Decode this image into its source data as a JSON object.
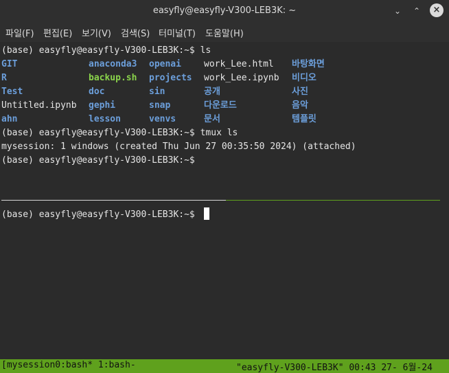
{
  "window": {
    "title": "easyfly@easyfly-V300-LEB3K: ~",
    "controls": [
      "minimize-icon",
      "maximize-icon",
      "close-icon"
    ]
  },
  "menu": [
    "파일(F)",
    "편집(E)",
    "보기(V)",
    "검색(S)",
    "터미널(T)",
    "도움말(H)"
  ],
  "terminal": {
    "prompt_ls": "(base) easyfly@easyfly-V300-LEB3K:~$ ls",
    "ls_rows": [
      [
        {
          "text": "GIT",
          "kind": "dir"
        },
        {
          "text": "anaconda3",
          "kind": "dir"
        },
        {
          "text": "openai",
          "kind": "dir"
        },
        {
          "text": "work_Lee.html",
          "kind": "file"
        },
        {
          "text": "바탕화면",
          "kind": "dir"
        }
      ],
      [
        {
          "text": "R",
          "kind": "dir"
        },
        {
          "text": "backup.sh",
          "kind": "exe"
        },
        {
          "text": "projects",
          "kind": "dir"
        },
        {
          "text": "work_Lee.ipynb",
          "kind": "file"
        },
        {
          "text": "비디오",
          "kind": "dir"
        }
      ],
      [
        {
          "text": "Test",
          "kind": "dir"
        },
        {
          "text": "doc",
          "kind": "dir"
        },
        {
          "text": "sin",
          "kind": "dir"
        },
        {
          "text": "공개",
          "kind": "dir"
        },
        {
          "text": "사진",
          "kind": "dir"
        }
      ],
      [
        {
          "text": "Untitled.ipynb",
          "kind": "file"
        },
        {
          "text": "gephi",
          "kind": "dir"
        },
        {
          "text": "snap",
          "kind": "dir"
        },
        {
          "text": "다운로드",
          "kind": "dir"
        },
        {
          "text": "음악",
          "kind": "dir"
        }
      ],
      [
        {
          "text": "ahn",
          "kind": "dir"
        },
        {
          "text": "lesson",
          "kind": "dir"
        },
        {
          "text": "venvs",
          "kind": "dir"
        },
        {
          "text": "문서",
          "kind": "dir"
        },
        {
          "text": "템플릿",
          "kind": "dir"
        }
      ]
    ],
    "prompt_tmux": "(base) easyfly@easyfly-V300-LEB3K:~$ tmux ls",
    "tmux_output": "mysession: 1 windows (created Thu Jun 27 00:35:50 2024) (attached)",
    "prompt_empty": "(base) easyfly@easyfly-V300-LEB3K:~$",
    "pane2_prompt": "(base) easyfly@easyfly-V300-LEB3K:~$"
  },
  "status": {
    "left": "[mysession0:bash* 1:bash-",
    "right": "\"easyfly-V300-LEB3K\" 00:43 27- 6월-24"
  },
  "colors": {
    "dir": "#6c9fdb",
    "exe": "#8ad34b",
    "status_bg": "#5fa11d"
  }
}
